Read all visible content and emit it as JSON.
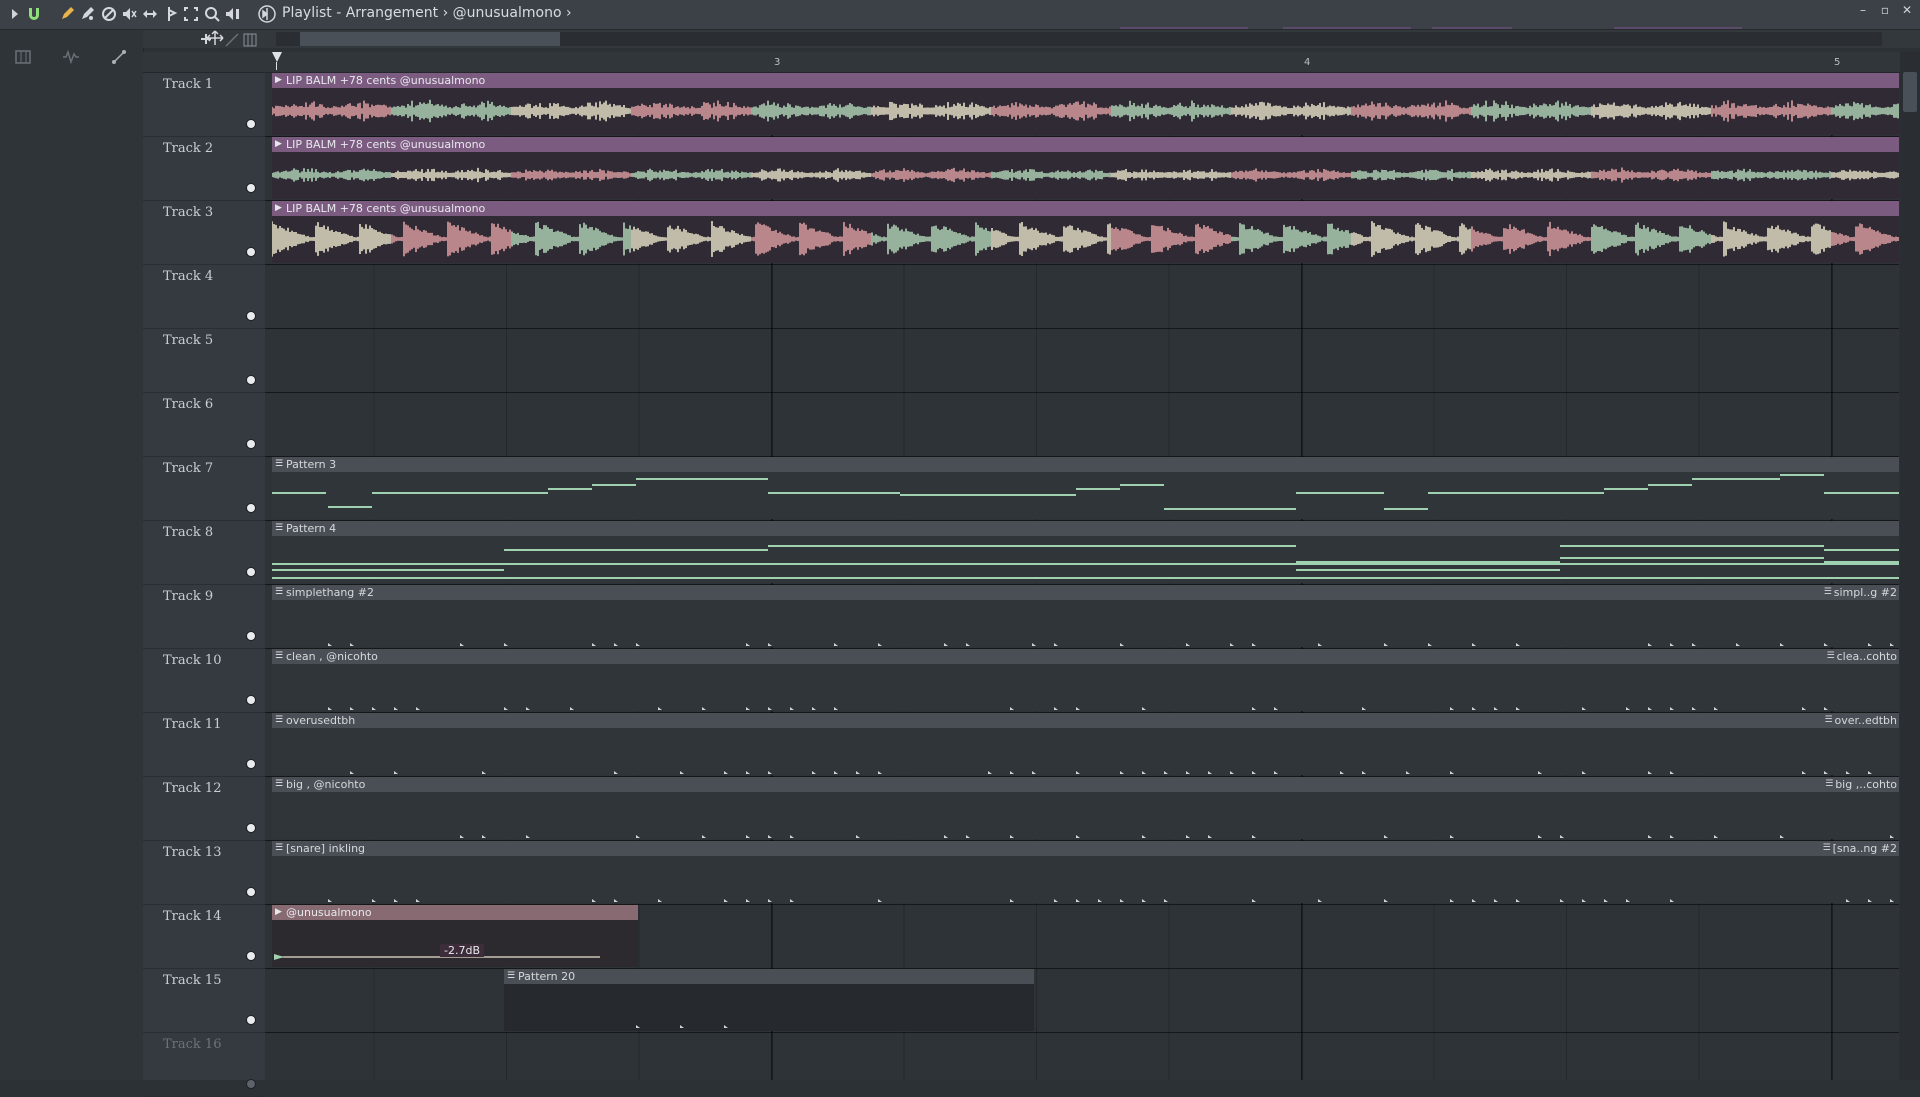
{
  "window": {
    "title": "Playlist - Arrangement",
    "breadcrumb_sep": "›",
    "arrangement": "@unusualmono",
    "breadcrumb_end": "›"
  },
  "window_controls": {
    "minimize": "–",
    "maximize": "▫",
    "close": "✕"
  },
  "toolbar_icons": [
    "arrow-right-icon",
    "magnet-icon",
    "pencil-icon",
    "paint-icon",
    "delete-icon",
    "mute-icon",
    "slip-icon",
    "slice-icon",
    "select-icon",
    "zoom-icon",
    "playback-icon"
  ],
  "ruler": {
    "markers": [
      "3",
      "4",
      "5"
    ]
  },
  "tracks": [
    {
      "name": "Track 1"
    },
    {
      "name": "Track 2"
    },
    {
      "name": "Track 3"
    },
    {
      "name": "Track 4"
    },
    {
      "name": "Track 5"
    },
    {
      "name": "Track 6"
    },
    {
      "name": "Track 7"
    },
    {
      "name": "Track 8"
    },
    {
      "name": "Track 9"
    },
    {
      "name": "Track 10"
    },
    {
      "name": "Track 11"
    },
    {
      "name": "Track 12"
    },
    {
      "name": "Track 13"
    },
    {
      "name": "Track 14"
    },
    {
      "name": "Track 15"
    },
    {
      "name": "Track 16"
    }
  ],
  "clips": {
    "t1": "LIP BALM +78 cents @unusualmono",
    "t2": "LIP BALM +78 cents @unusualmono",
    "t3": "LIP BALM +78 cents @unusualmono",
    "t7": "Pattern 3",
    "t8": "Pattern 4",
    "t9": "simplethang #2",
    "t9_end": "simpl..g #2",
    "t10": "clean , @nicohto",
    "t10_end": "clea..cohto",
    "t11": "overusedtbh",
    "t11_end": "over..edtbh",
    "t12": "big , @nicohto",
    "t12_end": "big ,..cohto",
    "t13": "[snare] inkling",
    "t13_end": "[sna..ng #2",
    "t14": "@unusualmono",
    "t14_volume": "-2.7dB",
    "t15": "Pattern 20"
  },
  "colors": {
    "audio_clip_header": "#7c5b80",
    "wave_cream": "#f1ecd0",
    "wave_pink": "#e6a5a8",
    "wave_green": "#b9dfc0",
    "note_green": "#9fd1b0"
  }
}
